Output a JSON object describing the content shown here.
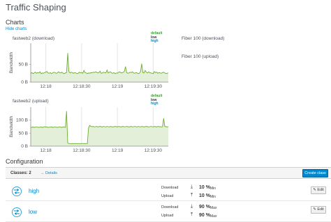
{
  "page": {
    "title": "Traffic Shaping"
  },
  "charts_section": {
    "title": "Charts",
    "hide_link": "Hide charts"
  },
  "links": [
    {
      "label": "Fiber 100 (download)"
    },
    {
      "label": "Fiber 100 (upload)"
    }
  ],
  "legend": [
    {
      "label": "default",
      "color": "#3f9c35"
    },
    {
      "label": "low",
      "color": "#363636"
    },
    {
      "label": "high",
      "color": "#0088ce"
    }
  ],
  "chart_data": [
    {
      "type": "area",
      "title": "fastweb2 (download)",
      "ylabel": "Bandwidth",
      "y_ticks": [
        "0 B",
        "50 B"
      ],
      "y_tick_values": [
        0,
        50
      ],
      "ylim": [
        0,
        110
      ],
      "x_ticks": [
        "12:18",
        "12:18:30",
        "12:19",
        "12:19:30"
      ],
      "x_tick_positions": [
        0.11,
        0.37,
        0.63,
        0.89
      ],
      "series": [
        {
          "name": "default",
          "color": "#6aaf2f",
          "values": [
            25,
            27,
            24,
            26,
            28,
            25,
            27,
            26,
            29,
            24,
            26,
            25,
            27,
            28,
            30,
            26,
            25,
            27,
            24,
            26,
            28,
            27,
            25,
            26,
            29,
            27,
            26,
            28,
            25,
            24,
            26,
            27,
            82,
            30,
            26,
            28,
            27,
            25,
            27,
            26,
            24,
            25,
            28,
            26,
            27,
            25,
            33,
            27,
            26,
            24,
            26,
            25,
            27,
            26,
            28,
            27,
            29,
            28,
            26,
            27,
            31,
            25,
            26,
            28,
            27,
            26,
            34,
            26,
            28,
            29,
            26,
            25,
            27,
            24,
            26,
            25,
            28,
            29,
            27,
            26,
            28,
            30,
            44,
            27,
            25,
            26,
            28,
            27,
            29,
            26,
            25,
            27,
            26,
            24,
            25,
            30,
            52,
            27,
            26,
            33,
            28,
            26,
            29,
            27,
            26,
            25,
            24,
            30,
            27,
            28,
            25,
            27,
            26,
            25,
            27,
            28,
            26,
            24,
            25,
            26
          ]
        }
      ],
      "grid": true,
      "legend_position": "top-right"
    },
    {
      "type": "area",
      "title": "fastweb2 (upload)",
      "ylabel": "Bandwidth",
      "y_ticks": [
        "0 B",
        "50 B",
        "100 B"
      ],
      "y_tick_values": [
        0,
        50,
        100
      ],
      "ylim": [
        0,
        150
      ],
      "x_ticks": [
        "12:18",
        "12:18:30",
        "12:19",
        "12:19:30"
      ],
      "x_tick_positions": [
        0.11,
        0.37,
        0.63,
        0.89
      ],
      "series": [
        {
          "name": "default",
          "color": "#6aaf2f",
          "values": [
            73,
            72,
            74,
            72,
            73,
            74,
            73,
            72,
            73,
            74,
            72,
            73,
            75,
            73,
            74,
            72,
            73,
            73,
            74,
            72,
            73,
            74,
            73,
            72,
            73,
            74,
            73,
            72,
            74,
            73,
            72,
            135,
            12,
            10,
            10,
            9,
            10,
            9,
            10,
            10,
            9,
            10,
            10,
            9,
            10,
            10,
            10,
            9,
            10,
            10,
            70,
            80,
            76,
            75,
            76,
            74,
            75,
            76,
            74,
            75,
            76,
            75,
            74,
            76,
            75,
            74,
            76,
            75,
            74,
            76,
            75,
            74,
            75,
            76,
            75,
            74,
            76,
            75,
            74,
            75,
            76,
            74,
            75,
            76,
            75,
            74,
            75,
            76,
            74,
            75,
            76,
            75,
            74,
            76,
            75,
            74,
            76,
            75,
            74,
            75,
            76,
            75,
            74,
            75,
            76,
            75,
            74,
            76,
            75,
            74,
            76,
            75,
            75,
            74,
            75,
            107,
            76,
            75,
            74,
            75
          ]
        }
      ],
      "grid": true,
      "legend_position": "top-right"
    }
  ],
  "configuration": {
    "title": "Configuration",
    "classes_label": "Classes: 2",
    "details_link": "→ Details",
    "create_button": "Create class",
    "classes": [
      {
        "name": "high",
        "download_label": "Download",
        "download_value": "10 %",
        "download_unit": "Min",
        "upload_label": "Upload",
        "upload_value": "10 %",
        "upload_unit": "Min",
        "edit_label": "Edit"
      },
      {
        "name": "low",
        "download_label": "Download",
        "download_value": "90 %",
        "download_unit": "Max",
        "upload_label": "Upload",
        "upload_value": "90 %",
        "upload_unit": "Max",
        "edit_label": "Edit"
      }
    ]
  },
  "icons": {
    "download": "download-icon",
    "upload": "upload-icon",
    "class": "traffic-class-icon",
    "edit": "pencil-icon",
    "menu": "kebab-icon"
  }
}
